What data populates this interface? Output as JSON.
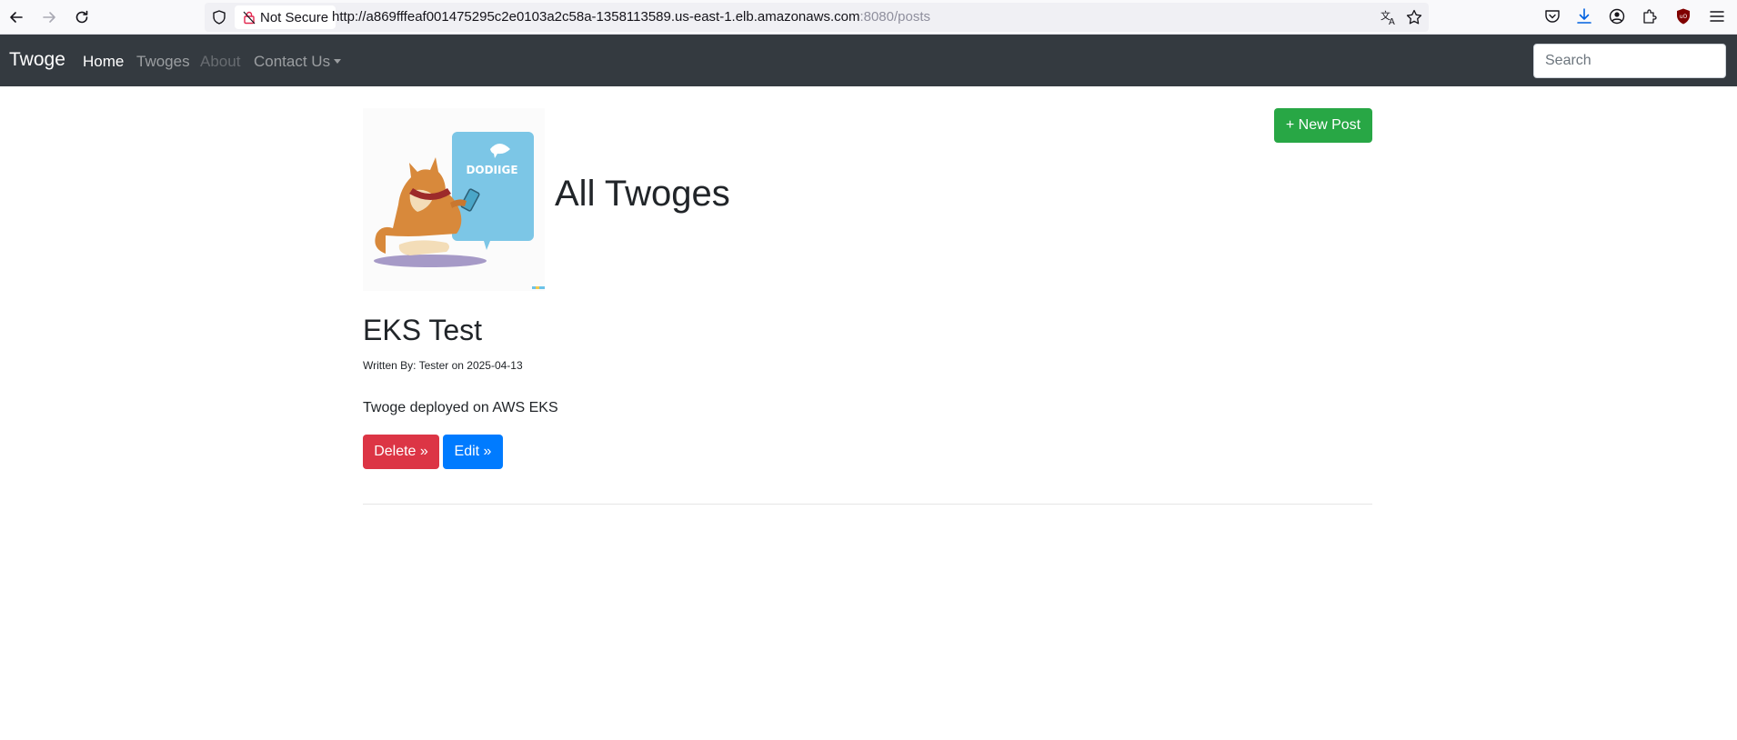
{
  "browser": {
    "security_label": "Not Secure",
    "url_main": "http://a869fffeaf001475295c2e0103a2c58a-1358113589.us-east-1.elb.amazonaws.com",
    "url_dim": ":8080/posts",
    "icons": [
      "back-icon",
      "forward-icon",
      "reload-icon",
      "shield-icon",
      "lock-icon",
      "translate-icon",
      "bookmark-star-icon",
      "pocket-icon",
      "download-icon",
      "account-icon",
      "extensions-icon",
      "ublock-icon",
      "menu-icon"
    ]
  },
  "navbar": {
    "brand": "Twoge",
    "links": [
      {
        "label": "Home"
      },
      {
        "label": "Twoges"
      },
      {
        "label": "About"
      },
      {
        "label": "Contact Us"
      }
    ],
    "search_placeholder": "Search"
  },
  "page": {
    "logo_text": "DODIIGE",
    "title": "All Twoges",
    "new_post_label": "+ New Post"
  },
  "posts": [
    {
      "title": "EKS Test",
      "meta": "Written By: Tester on 2025-04-13",
      "body": "Twoge deployed on AWS EKS",
      "delete_label": "Delete »",
      "edit_label": "Edit »"
    }
  ],
  "colors": {
    "navbar_bg": "#343a40",
    "success": "#28a745",
    "danger": "#dc3545",
    "primary": "#007bff"
  }
}
